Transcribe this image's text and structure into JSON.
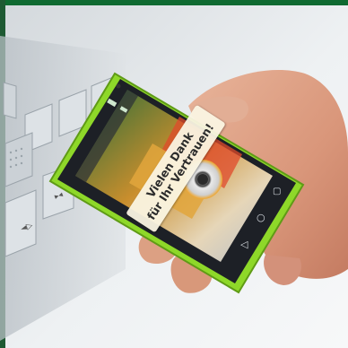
{
  "overlay": {
    "line1": "Vielen Dank",
    "line2": "für Ihr Vertrauen!"
  },
  "icons": [
    "elevator-button-icon",
    "android-back-icon",
    "android-home-icon",
    "android-recents-icon",
    "wifi-icon",
    "battery-icon"
  ],
  "colors": {
    "frame_green": "#8ed829",
    "phone_body": "#1d2026",
    "background": "#e9ecef",
    "accent_green": "#1b8a3b"
  }
}
